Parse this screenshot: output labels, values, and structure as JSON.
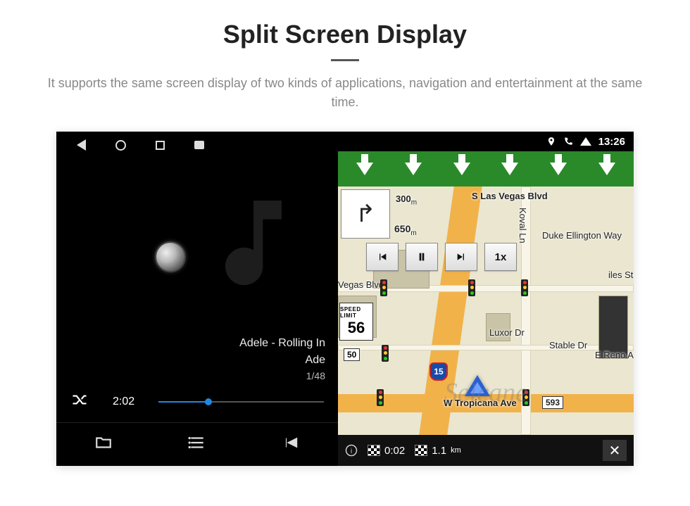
{
  "page": {
    "title": "Split Screen Display",
    "subtitle": "It supports the same screen display of two kinds of applications, navigation and entertainment at the same time."
  },
  "status_bar": {
    "time": "13:26"
  },
  "music": {
    "track_title": "Adele - Rolling In",
    "artist": "Ade",
    "track_index": "1/48",
    "elapsed": "2:02"
  },
  "nav": {
    "next_turn_distance": "300",
    "next_turn_unit": "m",
    "following_distance": "650",
    "following_unit": "m",
    "speed_limit_label": "SPEED LIMIT",
    "speed_limit_value": "56",
    "playback_speed": "1x",
    "roads": {
      "s_las_vegas": "S Las Vegas Blvd",
      "koval": "Koval Ln",
      "duke": "Duke Ellington Way",
      "vegas_blvd2": "Vegas Blvd",
      "luxor": "Luxor Dr",
      "stable": "Stable Dr",
      "reno": "E Reno Ave",
      "tropicana": "W Tropicana Ave",
      "tropicana_num": "593",
      "giles": "iles St"
    },
    "shields": {
      "route50": "50",
      "i15": "15"
    },
    "bottom": {
      "elapsed": "0:02",
      "remaining": "1.1",
      "remaining_unit": "km",
      "close": "✕"
    }
  },
  "watermark": "Seicane"
}
